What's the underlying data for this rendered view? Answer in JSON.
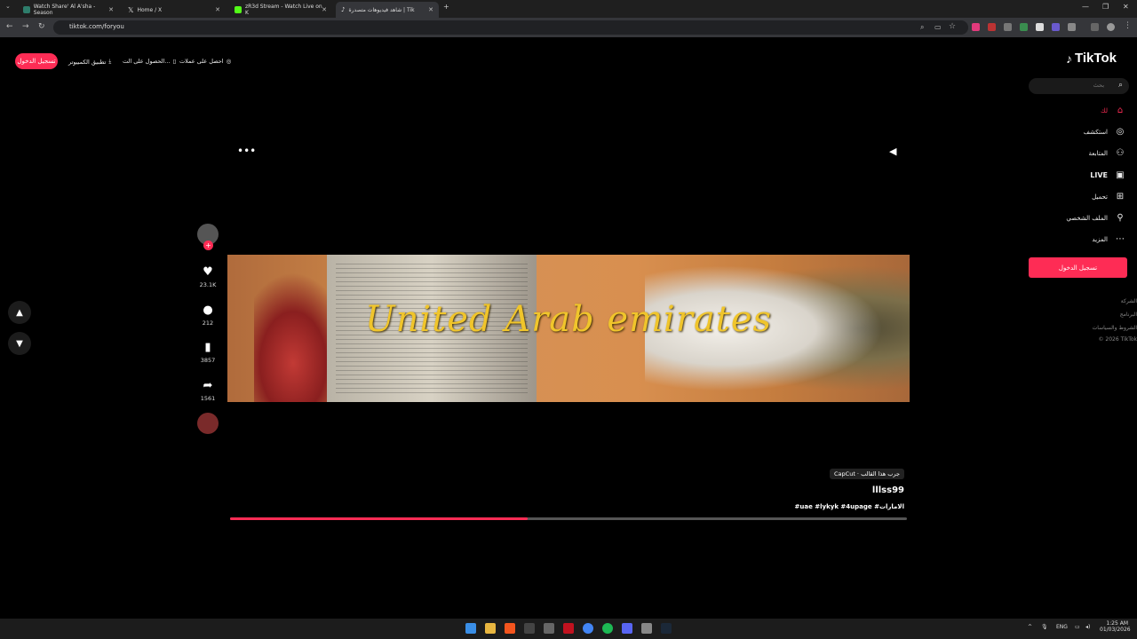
{
  "browser": {
    "tabs": [
      {
        "title": "Watch Share' Al A'sha - Season",
        "color": "#2e7d6b"
      },
      {
        "title": "Home / X",
        "color": "#000000"
      },
      {
        "title": "zR3d Stream - Watch Live on K",
        "color": "#53fc18"
      },
      {
        "title": "شاهد فيديوهات متصدرة | Tik",
        "color": "#000000"
      }
    ],
    "new_tab": "+",
    "url": "tiktok.com/foryou"
  },
  "tiktok": {
    "login_top": "تسجيل الدخول",
    "top_items": [
      "تطبيق الكمبيوتر",
      "الحصول على الت...",
      "احصل على عملات"
    ],
    "logo": "TikTok",
    "search_placeholder": "بحث",
    "nav": [
      "لك",
      "استكشف",
      "المتابعة",
      "LIVE",
      "تحميل",
      "الملف الشخصي",
      "المزيد"
    ],
    "sidebar_login": "تسجيل الدخول",
    "footer": [
      "الشركة",
      "البرنامج",
      "الشروط والسياسات",
      "© 2026 TikTok"
    ],
    "video_overlay_text": "United Arab emirates",
    "capcut_label": "CapCut · جرب هذا القالب",
    "author": "lllss99",
    "hashtags": "#uae #lykyk #4upage #الامارات",
    "likes": "23.1K",
    "comments": "212",
    "saves": "3857",
    "shares": "1561",
    "progress_pct": 44,
    "accent": "#fe2c55"
  },
  "taskbar": {
    "lang": "ENG",
    "time": "1:25 AM",
    "date": "01/03/2026"
  }
}
